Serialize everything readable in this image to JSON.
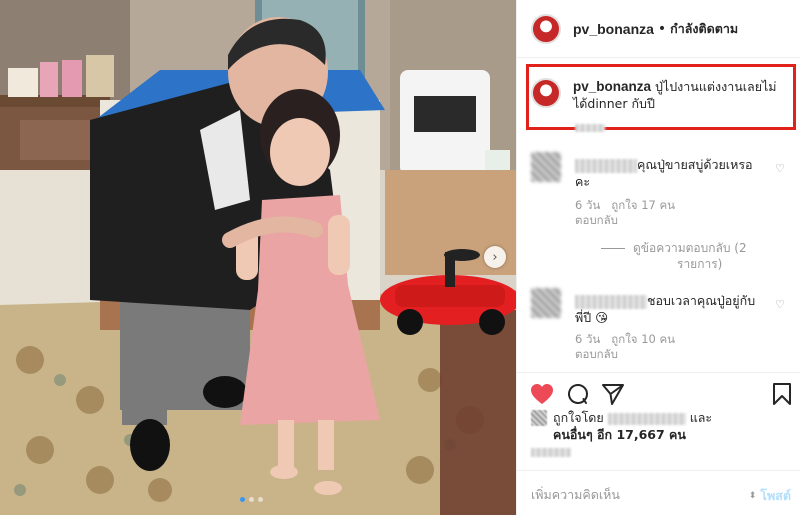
{
  "post": {
    "username": "pv_bonanza",
    "separator": "•",
    "follow_status": "กำลังติดตาม",
    "caption": "ปู่ไปงานแต่งงานเลยไม่ได้dinner กับปี",
    "caption_line1": "ปู่ไปงานแต่งงานเลยไม่",
    "caption_line2": "ได้dinner กับปี",
    "highlight_color": "#e0221b",
    "carousel_next_icon": "chevron-right-icon",
    "carousel_dots": 3,
    "carousel_active": 0
  },
  "comments": [
    {
      "text_line1": "คุณปู่ขายสบู่ด้วยเหรอ",
      "text_line2": "คะ",
      "age": "6 วัน",
      "likes": "ถูกใจ 17 คน",
      "reply": "ตอบกลับ"
    },
    {
      "text_line1": "ชอบเวลาคุณปู่อยู่กับ",
      "text_line2": "พี่ปี 😘",
      "age": "6 วัน",
      "likes": "ถูกใจ 10 คน",
      "reply": "ตอบกลับ"
    }
  ],
  "view_replies_line1": "ดูข้อความตอบกลับ (2",
  "view_replies_line2": "รายการ)",
  "likes": {
    "prefix": "ถูกใจโดย",
    "suffix": "และ",
    "others_label": "คนอื่นๆ อีก 17,667 คน"
  },
  "add_comment": {
    "placeholder": "เพิ่มความคิดเห็น",
    "post_label": "โพสต์"
  },
  "colors": {
    "like_heart": "#ed4956",
    "post_button": "#b2dffc",
    "link_blue": "#3897f0"
  },
  "icons": [
    "heart-icon",
    "comment-icon",
    "share-icon",
    "bookmark-icon",
    "small-heart-icon"
  ]
}
